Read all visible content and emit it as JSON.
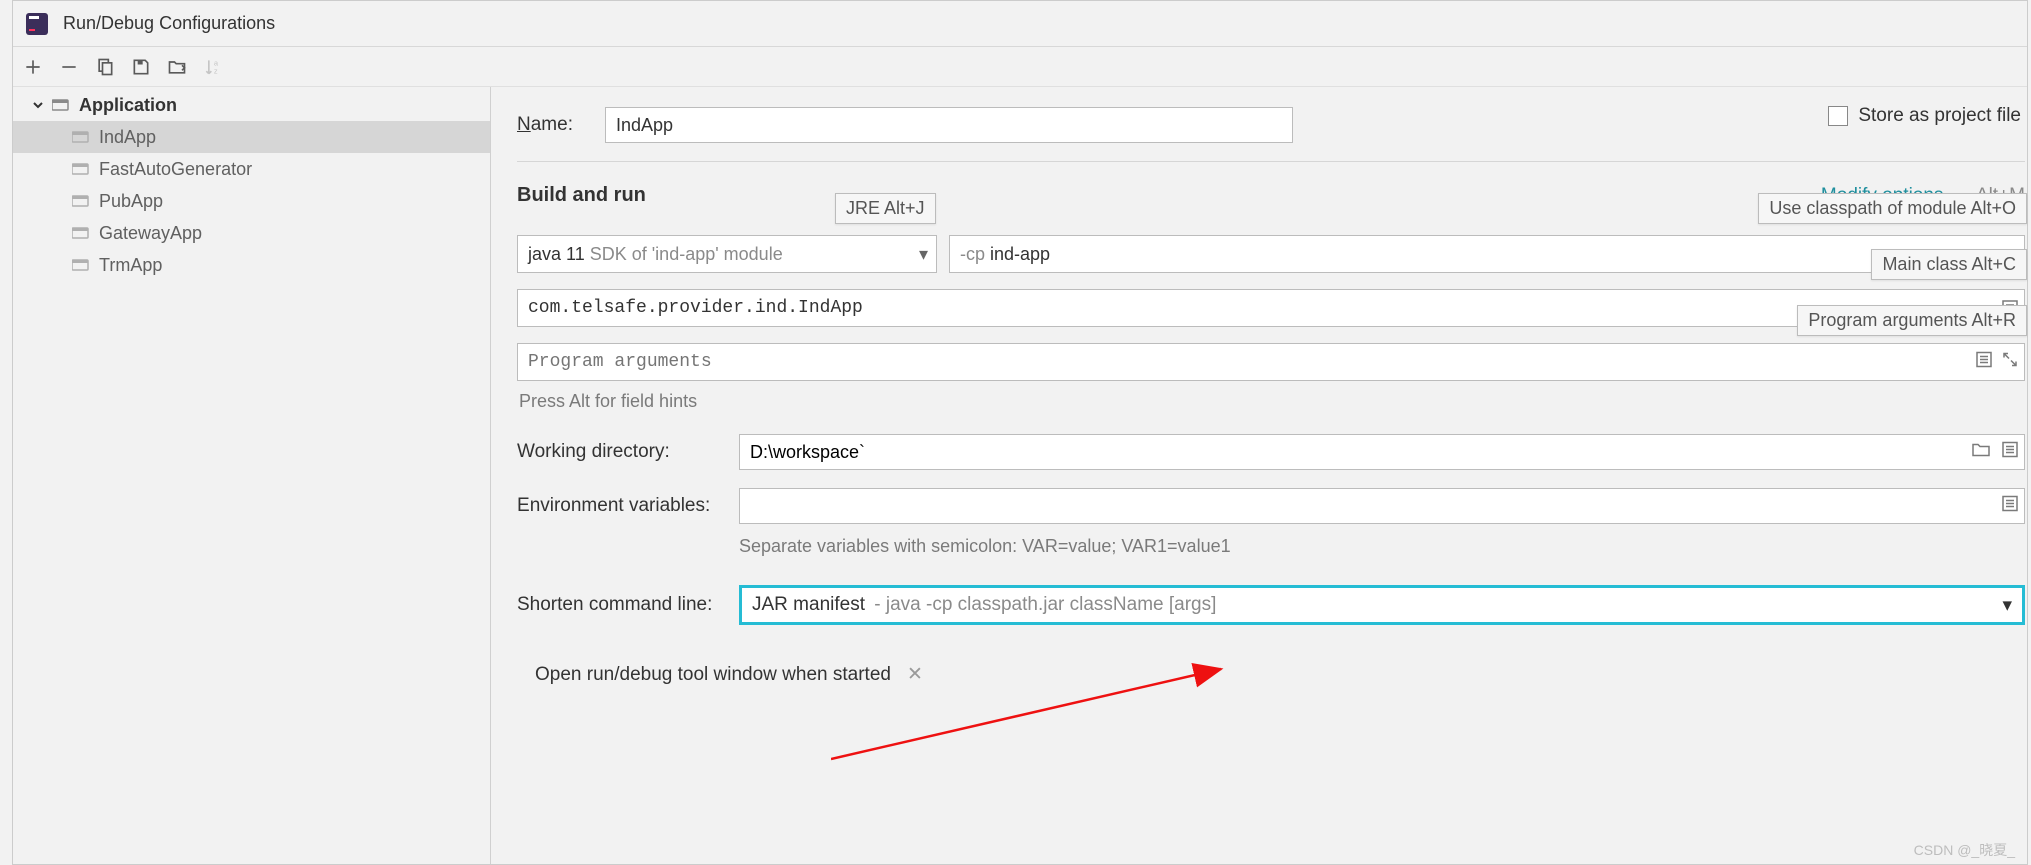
{
  "window": {
    "title": "Run/Debug Configurations"
  },
  "toolbar": {
    "add": "+",
    "remove": "−",
    "copy": "copy",
    "save": "save",
    "folder": "folder",
    "sort": "sort"
  },
  "tree": {
    "root": "Application",
    "children": [
      {
        "label": "IndApp",
        "selected": true
      },
      {
        "label": "FastAutoGenerator"
      },
      {
        "label": "PubApp"
      },
      {
        "label": "GatewayApp"
      },
      {
        "label": "TrmApp"
      }
    ]
  },
  "form": {
    "name_label_pre": "N",
    "name_label_post": "ame:",
    "name_value": "IndApp",
    "store_label_pre": "S",
    "store_label_post": "tore as project file",
    "build_section": "Build and run",
    "modify_options": "Modify options",
    "modify_shortcut": "Alt+M",
    "hint_jre": "JRE Alt+J",
    "hint_cp": "Use classpath of module Alt+O",
    "hint_main": "Main class Alt+C",
    "hint_args": "Program arguments Alt+R",
    "jre_prefix": "java 11 ",
    "jre_gray": "SDK of 'ind-app' module",
    "cp_prefix": "-cp ",
    "cp_value": "ind-app",
    "main_class": "com.telsafe.provider.ind.IndApp",
    "prog_args_placeholder": "Program arguments",
    "press_alt": "Press Alt for field hints",
    "wd_label_pre": "W",
    "wd_label_post": "orking directory:",
    "wd_value": "D:\\workspace`",
    "env_label_pre": "E",
    "env_label_post": "nvironment variables:",
    "env_value": "",
    "env_hint": "Separate variables with semicolon: VAR=value; VAR1=value1",
    "shorten_label_pre": "Shorten command ",
    "shorten_label_u": "l",
    "shorten_label_post": "ine:",
    "shorten_value": "JAR manifest",
    "shorten_sub": " - java -cp classpath.jar className [args]",
    "open_tool": "Open run/debug tool window when started"
  },
  "watermark": "CSDN @_晓夏_"
}
